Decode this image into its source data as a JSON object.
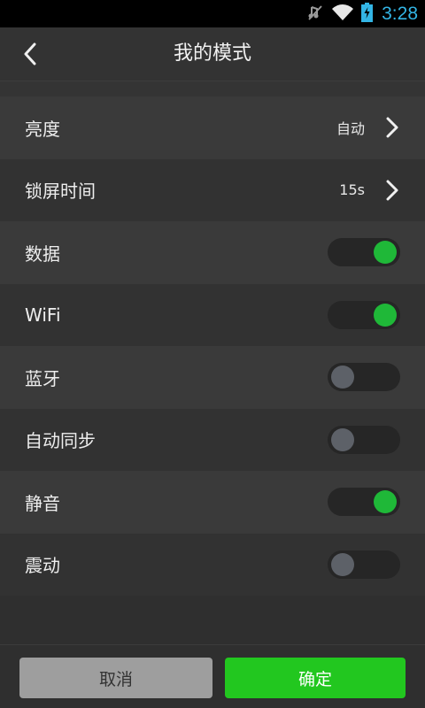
{
  "status_bar": {
    "time": "3:28",
    "accent_color": "#33b5e5",
    "icons": [
      "mute-icon",
      "wifi-icon",
      "battery-charging-icon"
    ]
  },
  "header": {
    "title": "我的模式",
    "back_icon": "chevron-left-icon"
  },
  "settings": {
    "brightness": {
      "label": "亮度",
      "value": "自动"
    },
    "screen_lock": {
      "label": "锁屏时间",
      "value": "15s"
    },
    "data": {
      "label": "数据",
      "on": true
    },
    "wifi": {
      "label": "WiFi",
      "on": true
    },
    "bluetooth": {
      "label": "蓝牙",
      "on": false
    },
    "auto_sync": {
      "label": "自动同步",
      "on": false
    },
    "silent": {
      "label": "静音",
      "on": true
    },
    "vibrate": {
      "label": "震动",
      "on": false
    }
  },
  "colors": {
    "toggle_on": "#1fb838",
    "toggle_off": "#5d6168",
    "confirm": "#22c71f",
    "cancel": "#9e9e9e"
  },
  "footer": {
    "cancel_label": "取消",
    "confirm_label": "确定"
  }
}
